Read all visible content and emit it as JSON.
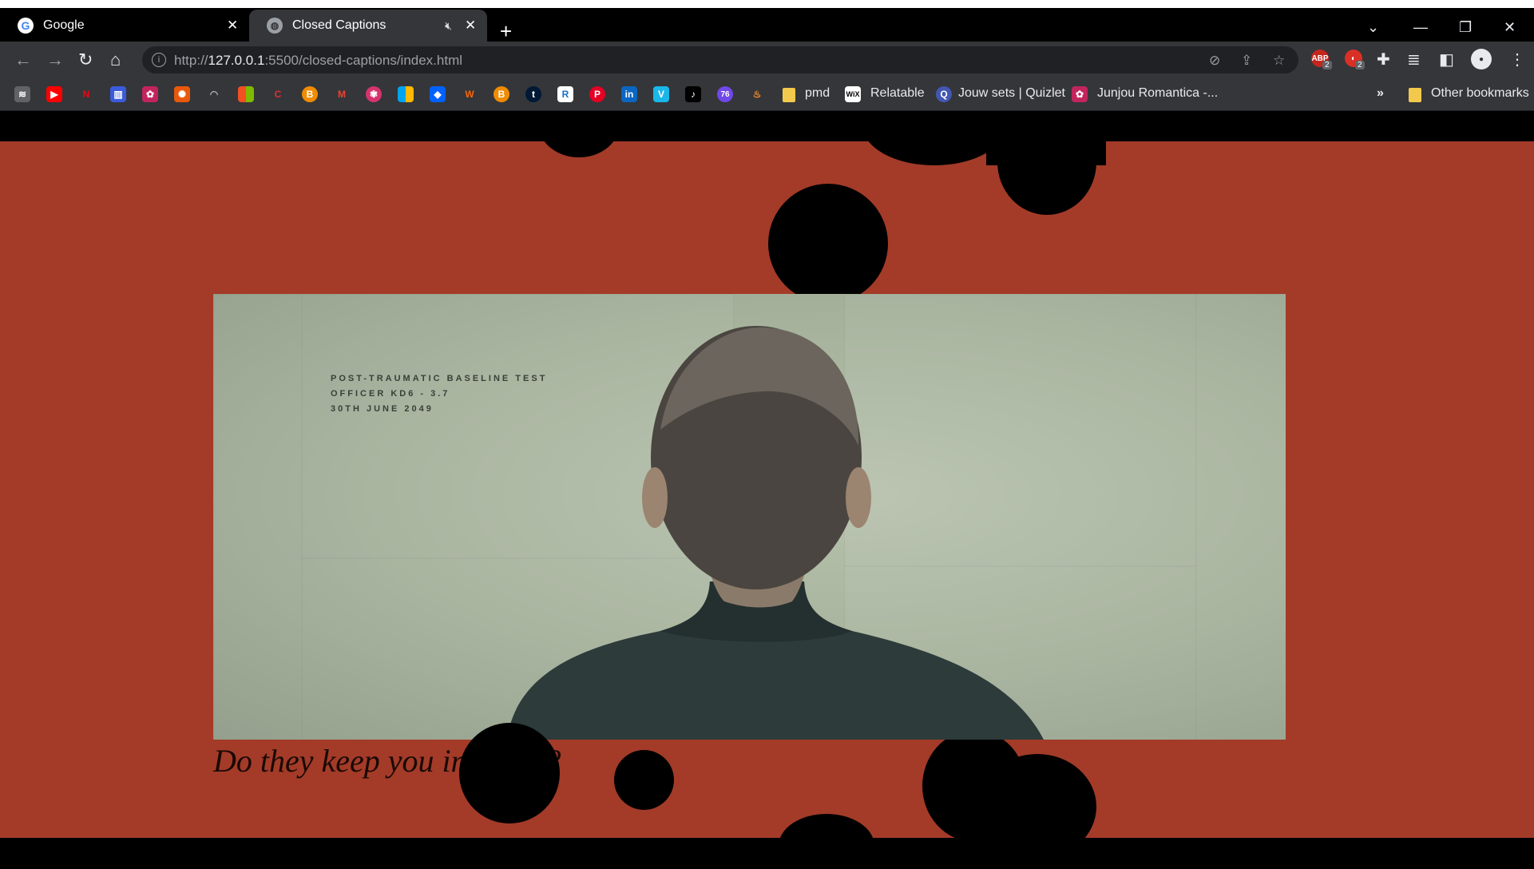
{
  "browser": {
    "tabs": [
      {
        "title": "Google",
        "icon": "google-icon",
        "active": false
      },
      {
        "title": "Closed Captions",
        "icon": "globe-icon",
        "active": true,
        "audio": "muted"
      }
    ],
    "url_prefix": "http://",
    "url_host": "127.0.0.1",
    "url_rest": ":5500/closed-captions/index.html",
    "extension_badges": {
      "abp": "2",
      "second": "2"
    },
    "bookmarks": [
      {
        "label": "pmd",
        "icon": "folder-icon"
      },
      {
        "label": "Relatable",
        "icon": "wix-icon"
      },
      {
        "label": "Jouw sets | Quizlet",
        "icon": "quizlet-icon"
      },
      {
        "label": "Junjou Romantica -...",
        "icon": "anime-icon"
      }
    ],
    "bookmarks_overflow": "»",
    "other_bookmarks": "Other bookmarks"
  },
  "video": {
    "overlay_lines": [
      "POST-TRAUMATIC BASELINE TEST",
      "OFFICER KD6 - 3.7",
      "30TH JUNE 2049"
    ]
  },
  "caption": {
    "text": "Do they keep you in a cell?"
  },
  "colors": {
    "stage": "#a33b28",
    "blobs": "#000000",
    "chrome": "#35363a"
  }
}
